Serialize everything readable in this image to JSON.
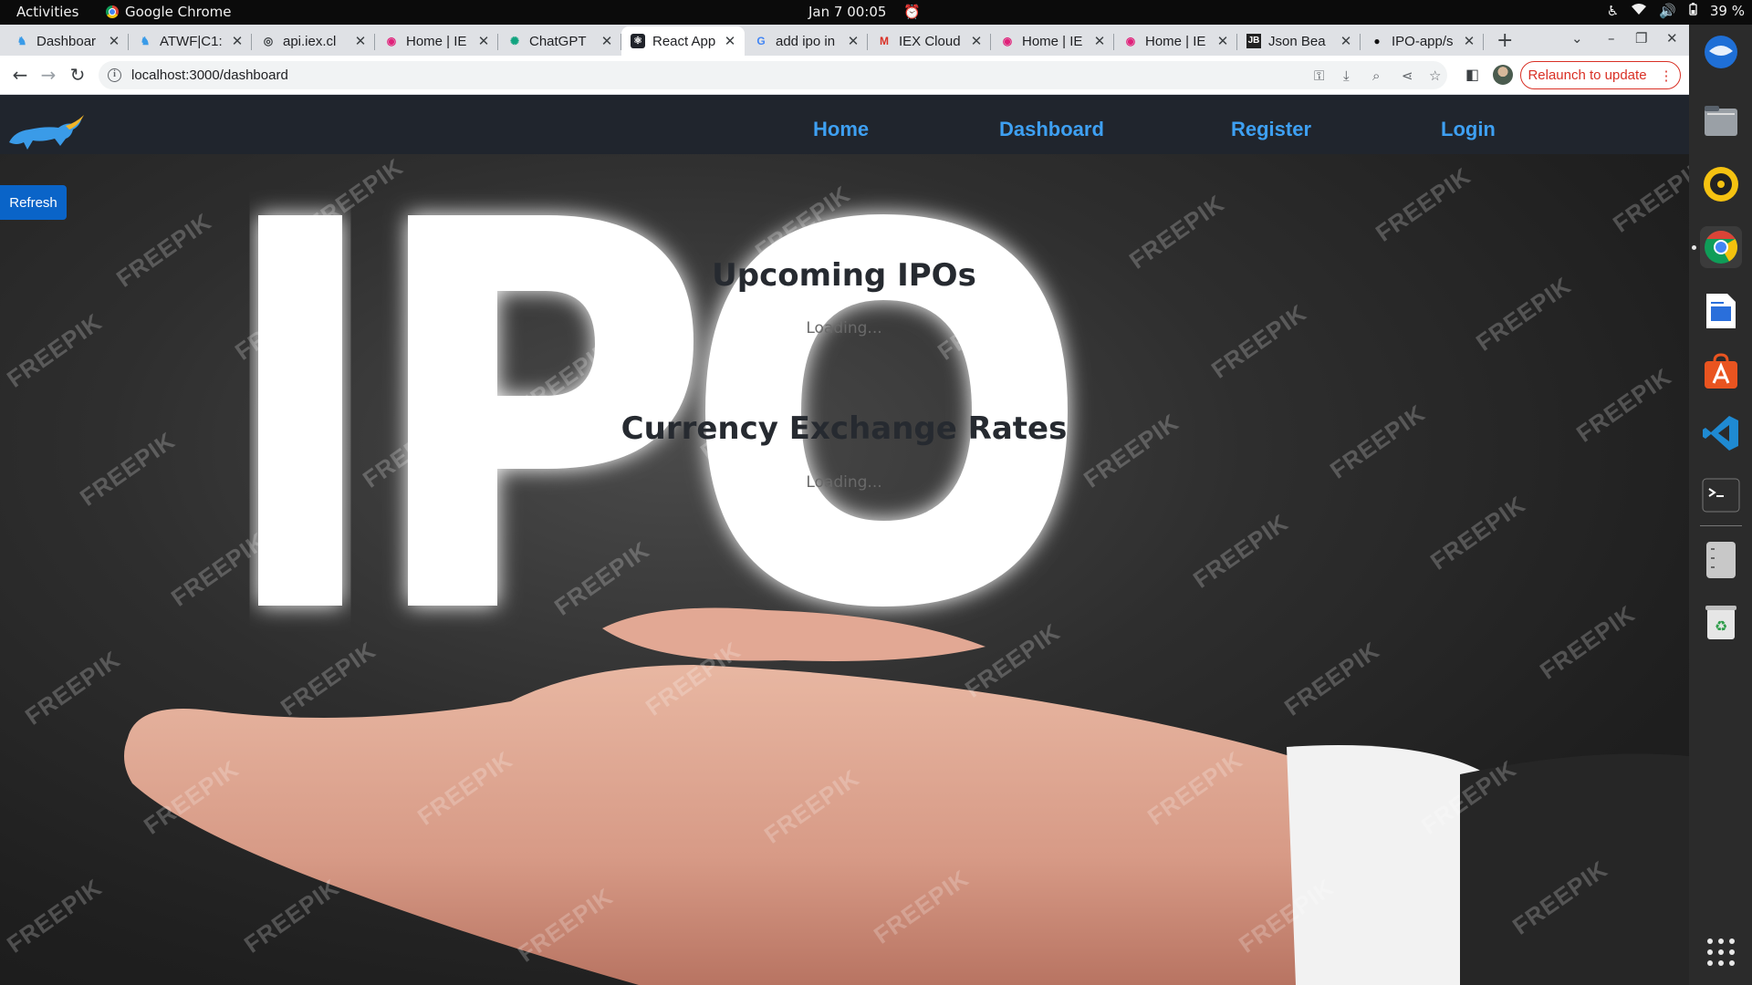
{
  "system_bar": {
    "activities": "Activities",
    "app_name": "Google Chrome",
    "clock": "Jan 7  00:05",
    "battery": "39 %"
  },
  "tabs": [
    {
      "title": "Dashboar",
      "favicon": "bull-icon",
      "active": false
    },
    {
      "title": "ATWF|C1:",
      "favicon": "bull-icon",
      "active": false
    },
    {
      "title": "api.iex.cl",
      "favicon": "globe-icon",
      "active": false
    },
    {
      "title": "Home | IE",
      "favicon": "iex-icon",
      "active": false
    },
    {
      "title": "ChatGPT",
      "favicon": "chatgpt-icon",
      "active": false
    },
    {
      "title": "React App",
      "favicon": "react-icon",
      "active": true
    },
    {
      "title": "add ipo in",
      "favicon": "google-icon",
      "active": false
    },
    {
      "title": "IEX Cloud",
      "favicon": "gmail-icon",
      "active": false
    },
    {
      "title": "Home | IE",
      "favicon": "iex-icon",
      "active": false
    },
    {
      "title": "Home | IE",
      "favicon": "iex-icon",
      "active": false
    },
    {
      "title": "Json Bea",
      "favicon": "jsonbeautify-icon",
      "active": false
    },
    {
      "title": "IPO-app/s",
      "favicon": "github-icon",
      "active": false
    }
  ],
  "toolbar": {
    "url": "localhost:3000/dashboard",
    "relaunch_label": "Relaunch to update"
  },
  "navbar": {
    "links": [
      "Home",
      "Dashboard",
      "Register",
      "Login"
    ]
  },
  "page": {
    "refresh_label": "Refresh",
    "ipo_section_title": "Upcoming IPOs",
    "ipo_loading": "Loading...",
    "currency_section_title": "Currency Exchange Rates",
    "currency_loading": "Loading...",
    "hero_text": "IPO",
    "watermark": "FREEPIK"
  },
  "colors": {
    "navbar_bg": "#20252d",
    "nav_link": "#3ea0f2",
    "refresh_bg": "#0a64c8",
    "relaunch": "#d93025"
  },
  "dock": {
    "items": [
      "thunderbird-icon",
      "files-icon",
      "rhythmbox-icon",
      "chrome-icon",
      "writer-icon",
      "app-center-icon",
      "vscode-icon",
      "terminal-icon",
      "drive-icon",
      "trash-icon",
      "show-apps-icon"
    ]
  }
}
